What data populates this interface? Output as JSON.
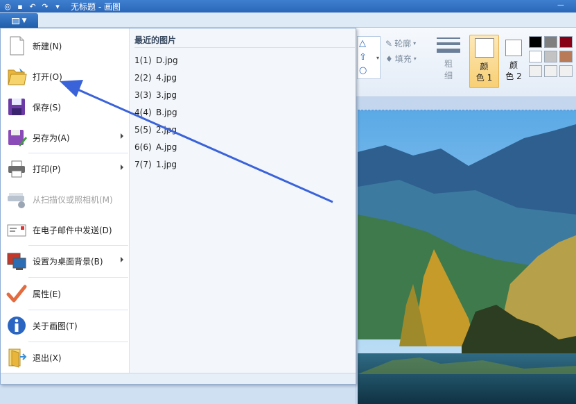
{
  "window": {
    "title": "无标题 - 画图"
  },
  "app_menu": {
    "items": [
      {
        "label": "新建(N)",
        "icon": "new-file-icon",
        "enabled": true,
        "submenu": false
      },
      {
        "label": "打开(O)",
        "icon": "open-folder-icon",
        "enabled": true,
        "submenu": false
      },
      {
        "label": "保存(S)",
        "icon": "floppy-disk-icon",
        "enabled": true,
        "submenu": false
      },
      {
        "label": "另存为(A)",
        "icon": "save-as-icon",
        "enabled": true,
        "submenu": true
      },
      {
        "label": "打印(P)",
        "icon": "printer-icon",
        "enabled": true,
        "submenu": true
      },
      {
        "label": "从扫描仪或照相机(M)",
        "icon": "scanner-icon",
        "enabled": false,
        "submenu": false
      },
      {
        "label": "在电子邮件中发送(D)",
        "icon": "email-icon",
        "enabled": true,
        "submenu": false
      },
      {
        "label": "设置为桌面背景(B)",
        "icon": "desktop-background-icon",
        "enabled": true,
        "submenu": true
      },
      {
        "label": "属性(E)",
        "icon": "checkmark-icon",
        "enabled": true,
        "submenu": false
      },
      {
        "label": "关于画图(T)",
        "icon": "info-icon",
        "enabled": true,
        "submenu": false
      },
      {
        "label": "退出(X)",
        "icon": "exit-icon",
        "enabled": true,
        "submenu": false
      }
    ],
    "recent_title": "最近的图片",
    "recent": [
      {
        "num": "1(1)",
        "file": "D.jpg"
      },
      {
        "num": "2(2)",
        "file": "4.jpg"
      },
      {
        "num": "3(3)",
        "file": "3.jpg"
      },
      {
        "num": "4(4)",
        "file": "B.jpg"
      },
      {
        "num": "5(5)",
        "file": "2.jpg"
      },
      {
        "num": "6(6)",
        "file": "A.jpg"
      },
      {
        "num": "7(7)",
        "file": "1.jpg"
      }
    ]
  },
  "ribbon": {
    "outline_label": "轮廓",
    "fill_label": "填充",
    "size_label": [
      "粗",
      "细"
    ],
    "color1_label": [
      "颜",
      "色 1"
    ],
    "color2_label": [
      "颜",
      "色 2"
    ],
    "palette": [
      "#000000",
      "#7f7f7f",
      "#880015",
      "#ffffff",
      "#c3c3c3",
      "#b97a57"
    ]
  },
  "annotation": {
    "arrow_color": "#3b63d9"
  }
}
